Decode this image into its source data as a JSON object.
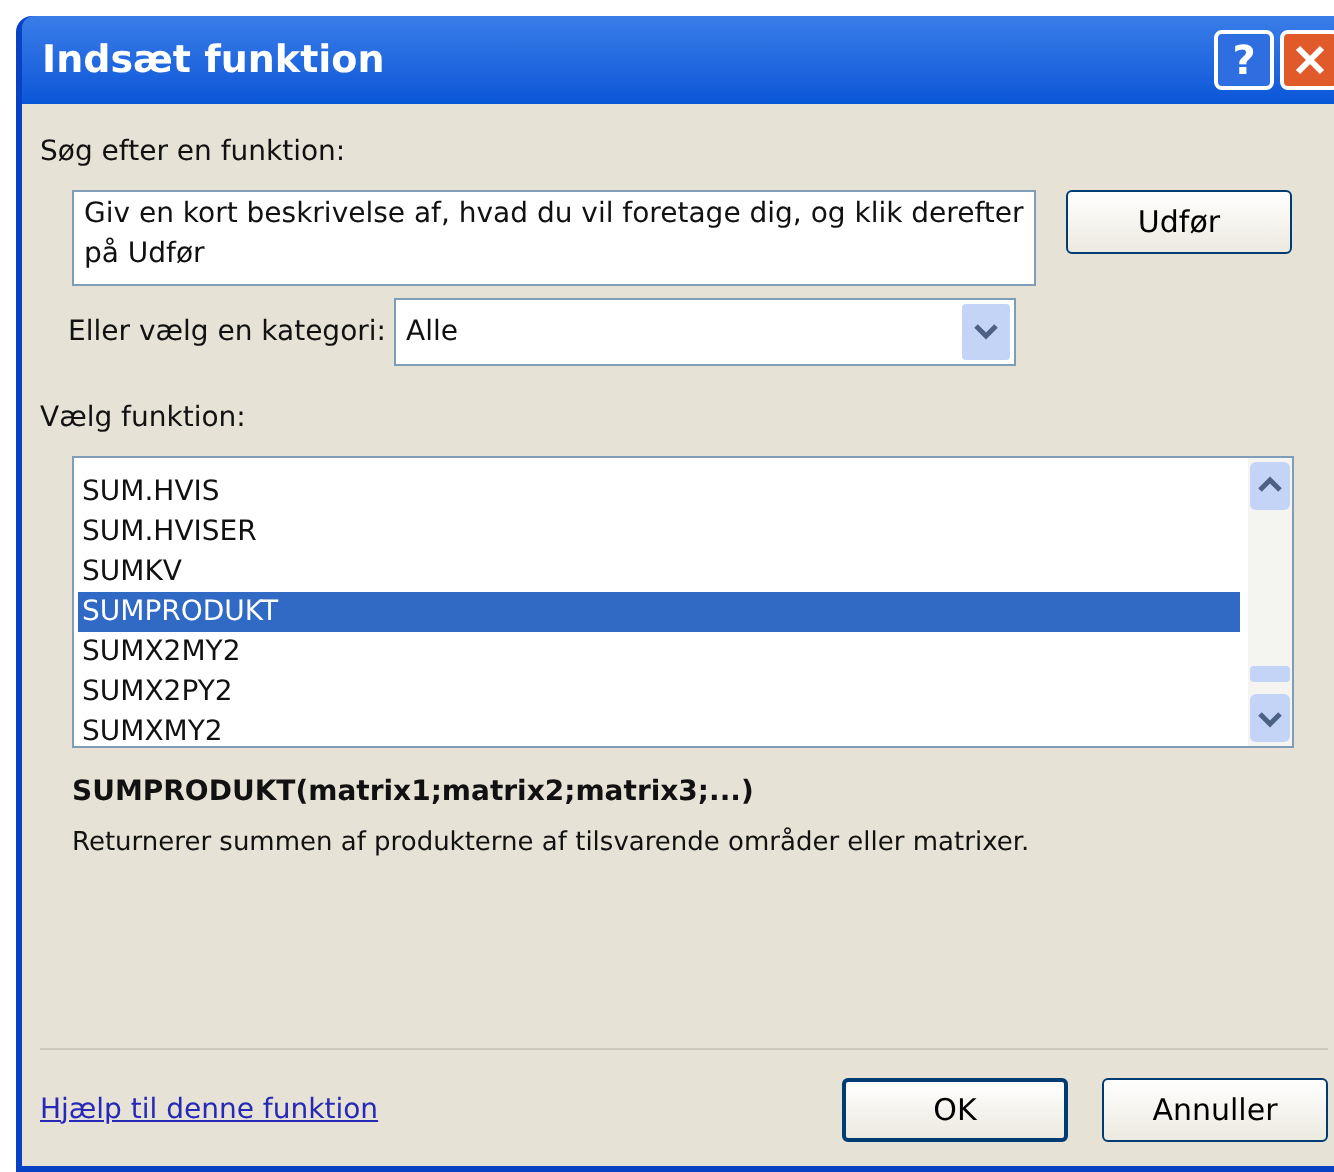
{
  "window": {
    "title": "Indsæt funktion",
    "help_button": "?"
  },
  "search": {
    "label": "Søg efter en funktion:",
    "value": "Giv en kort beskrivelse af, hvad du vil foretage dig, og klik derefter på Udfør",
    "button": "Udfør"
  },
  "category": {
    "label": "Eller vælg en kategori:",
    "value": "Alle"
  },
  "functions": {
    "label": "Vælg funktion:",
    "items": [
      {
        "name": "SUM.HVIS",
        "selected": false
      },
      {
        "name": "SUM.HVISER",
        "selected": false
      },
      {
        "name": "SUMKV",
        "selected": false
      },
      {
        "name": "SUMPRODUKT",
        "selected": true
      },
      {
        "name": "SUMX2MY2",
        "selected": false
      },
      {
        "name": "SUMX2PY2",
        "selected": false
      },
      {
        "name": "SUMXMY2",
        "selected": false
      }
    ]
  },
  "signature": "SUMPRODUKT(matrix1;matrix2;matrix3;...)",
  "description": "Returnerer summen af produkterne af tilsvarende områder eller matrixer.",
  "help_link": "Hjælp til denne funktion",
  "buttons": [
    "OK",
    "Annuller"
  ]
}
